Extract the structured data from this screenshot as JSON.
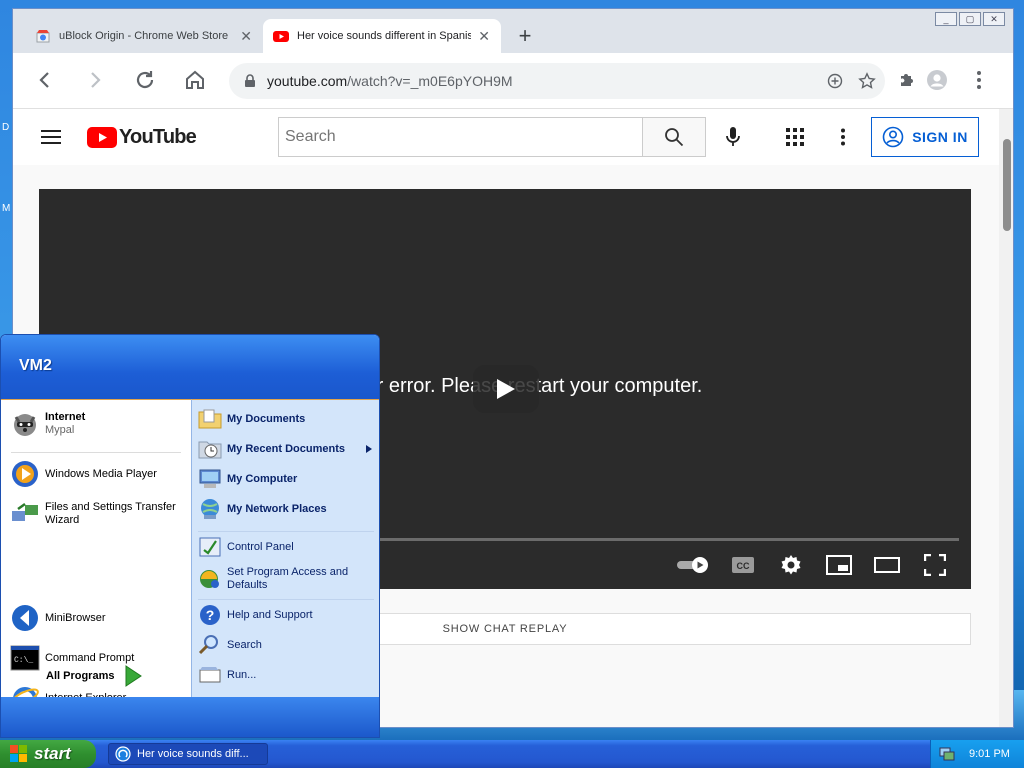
{
  "desktop": {
    "edge_letters": [
      "D",
      "M"
    ]
  },
  "browser": {
    "tabs": [
      {
        "title": "uBlock Origin - Chrome Web Store",
        "active": false
      },
      {
        "title": "Her voice sounds different in Spanish",
        "active": true
      }
    ],
    "new_tab_symbol": "+",
    "close_symbol": "✕",
    "window_buttons": [
      "_",
      "▢",
      "✕"
    ],
    "url_host": "youtube.com",
    "url_path": "/watch?v=_m0E6pYOH9M"
  },
  "youtube": {
    "logo_text": "YouTube",
    "search_placeholder": "Search",
    "sign_in_label": "SIGN IN",
    "player_error": "renderer error. Please restart your computer.",
    "show_chat_replay": "SHOW CHAT REPLAY",
    "cc_label": "CC"
  },
  "start_menu": {
    "user": "VM2",
    "pinned": [
      {
        "title": "Internet",
        "subtitle": "Mypal"
      }
    ],
    "recent": [
      {
        "title": "Windows Media Player"
      },
      {
        "title": "Files and Settings Transfer Wizard"
      },
      {
        "title": "MiniBrowser"
      },
      {
        "title": "Command Prompt"
      },
      {
        "title": "Internet Explorer"
      }
    ],
    "all_programs": "All Programs",
    "places": [
      {
        "title": "My Documents"
      },
      {
        "title": "My Recent Documents"
      },
      {
        "title": "My Computer"
      },
      {
        "title": "My Network Places"
      }
    ],
    "settings": [
      {
        "title": "Control Panel"
      },
      {
        "title": "Set Program Access and Defaults"
      }
    ],
    "tools": [
      {
        "title": "Help and Support"
      },
      {
        "title": "Search"
      },
      {
        "title": "Run..."
      }
    ]
  },
  "taskbar": {
    "start_label": "start",
    "task_title": "Her voice sounds diff...",
    "clock": "9:01 PM"
  }
}
